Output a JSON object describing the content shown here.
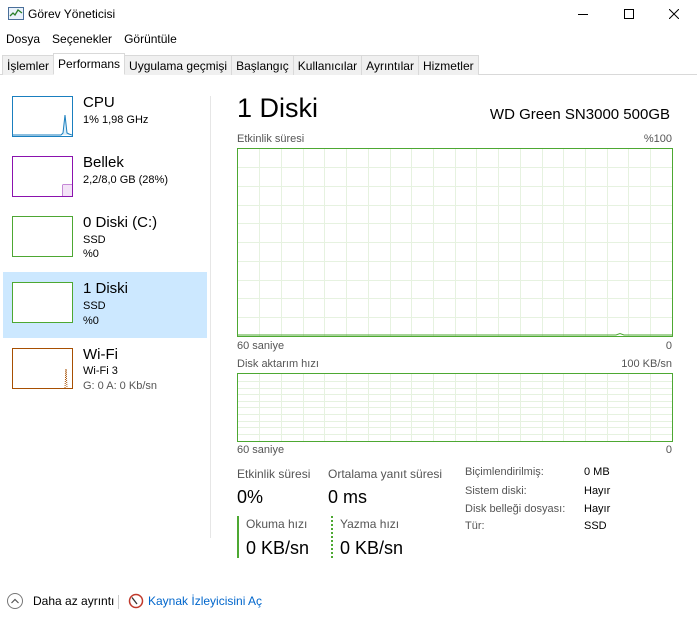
{
  "window": {
    "title": "Görev Yöneticisi",
    "icon": "task-manager-icon"
  },
  "menu": [
    "Dosya",
    "Seçenekler",
    "Görüntüle"
  ],
  "tabs": [
    {
      "label": "İşlemler",
      "active": false
    },
    {
      "label": "Performans",
      "active": true
    },
    {
      "label": "Uygulama geçmişi",
      "active": false
    },
    {
      "label": "Başlangıç",
      "active": false
    },
    {
      "label": "Kullanıcılar",
      "active": false
    },
    {
      "label": "Ayrıntılar",
      "active": false
    },
    {
      "label": "Hizmetler",
      "active": false
    }
  ],
  "sidebar": {
    "items": [
      {
        "title": "CPU",
        "line1": "1% 1,98 GHz",
        "line2": "",
        "color": "#1a7fbf",
        "selected": false
      },
      {
        "title": "Bellek",
        "line1": "2,2/8,0 GB (28%)",
        "line2": "",
        "color": "#8b12ae",
        "selected": false
      },
      {
        "title": "0 Diski (C:)",
        "line1": "SSD",
        "line2": "%0",
        "color": "#4da832",
        "selected": false
      },
      {
        "title": "1 Diski",
        "line1": "SSD",
        "line2": "%0",
        "color": "#4da832",
        "selected": true
      },
      {
        "title": "Wi-Fi",
        "line1": "Wi-Fi 3",
        "line2": "G: 0 A: 0 Kb/sn",
        "color": "#a74f01",
        "selected": false
      }
    ]
  },
  "main": {
    "title": "1 Diski",
    "model": "WD Green SN3000 500GB",
    "chart1": {
      "label": "Etkinlik süresi",
      "max": "%100",
      "time": "60 saniye",
      "min": "0"
    },
    "chart2": {
      "label": "Disk aktarım hızı",
      "max": "100 KB/sn",
      "time": "60 saniye",
      "min": "0"
    },
    "stats": {
      "active_label": "Etkinlik süresi",
      "active_value": "0%",
      "response_label": "Ortalama yanıt süresi",
      "response_value": "0 ms",
      "read_label": "Okuma hızı",
      "read_value": "0 KB/sn",
      "write_label": "Yazma hızı",
      "write_value": "0 KB/sn"
    },
    "details": [
      {
        "label": "Biçimlendirilmiş:",
        "value": "0 MB"
      },
      {
        "label": "Sistem diski:",
        "value": "Hayır"
      },
      {
        "label": "Disk belleği dosyası:",
        "value": "Hayır"
      },
      {
        "label": "Tür:",
        "value": "SSD"
      }
    ]
  },
  "footer": {
    "fewer_details": "Daha az ayrıntı",
    "resource_monitor": "Kaynak İzleyicisini Aç"
  },
  "colors": {
    "disk_green": "#4da832",
    "selection": "#cce8ff",
    "link": "#0066cc"
  }
}
